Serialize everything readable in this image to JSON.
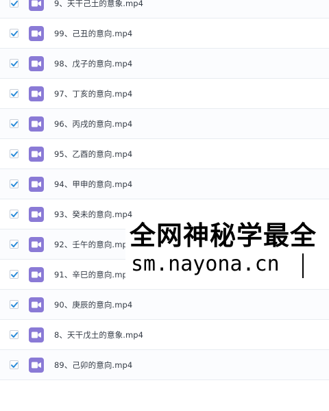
{
  "files": [
    {
      "name": "9、天干己土的意象.mp4",
      "checked": true
    },
    {
      "name": "99、己丑的意向.mp4",
      "checked": true
    },
    {
      "name": "98、戊子的意向.mp4",
      "checked": true
    },
    {
      "name": "97、丁亥的意向.mp4",
      "checked": true
    },
    {
      "name": "96、丙戌的意向.mp4",
      "checked": true
    },
    {
      "name": "95、乙酉的意向.mp4",
      "checked": true
    },
    {
      "name": "94、甲申的意向.mp4",
      "checked": true
    },
    {
      "name": "93、癸未的意向.mp4",
      "checked": true
    },
    {
      "name": "92、壬午的意向.mp4",
      "checked": true
    },
    {
      "name": "91、辛巳的意向.mp4",
      "checked": true
    },
    {
      "name": "90、庚辰的意向.mp4",
      "checked": true
    },
    {
      "name": "8、天干戊土的意象.mp4",
      "checked": true
    },
    {
      "name": "89、己卯的意向.mp4",
      "checked": true
    }
  ],
  "watermark": {
    "line1": "全网神秘学最全",
    "line2": "sm.nayona.cn"
  },
  "colors": {
    "checkmark": "#2a8bd8",
    "video_icon": "#8a7ad6"
  },
  "icons": {
    "checkbox": "checkmark-icon",
    "file": "video-file-icon"
  }
}
